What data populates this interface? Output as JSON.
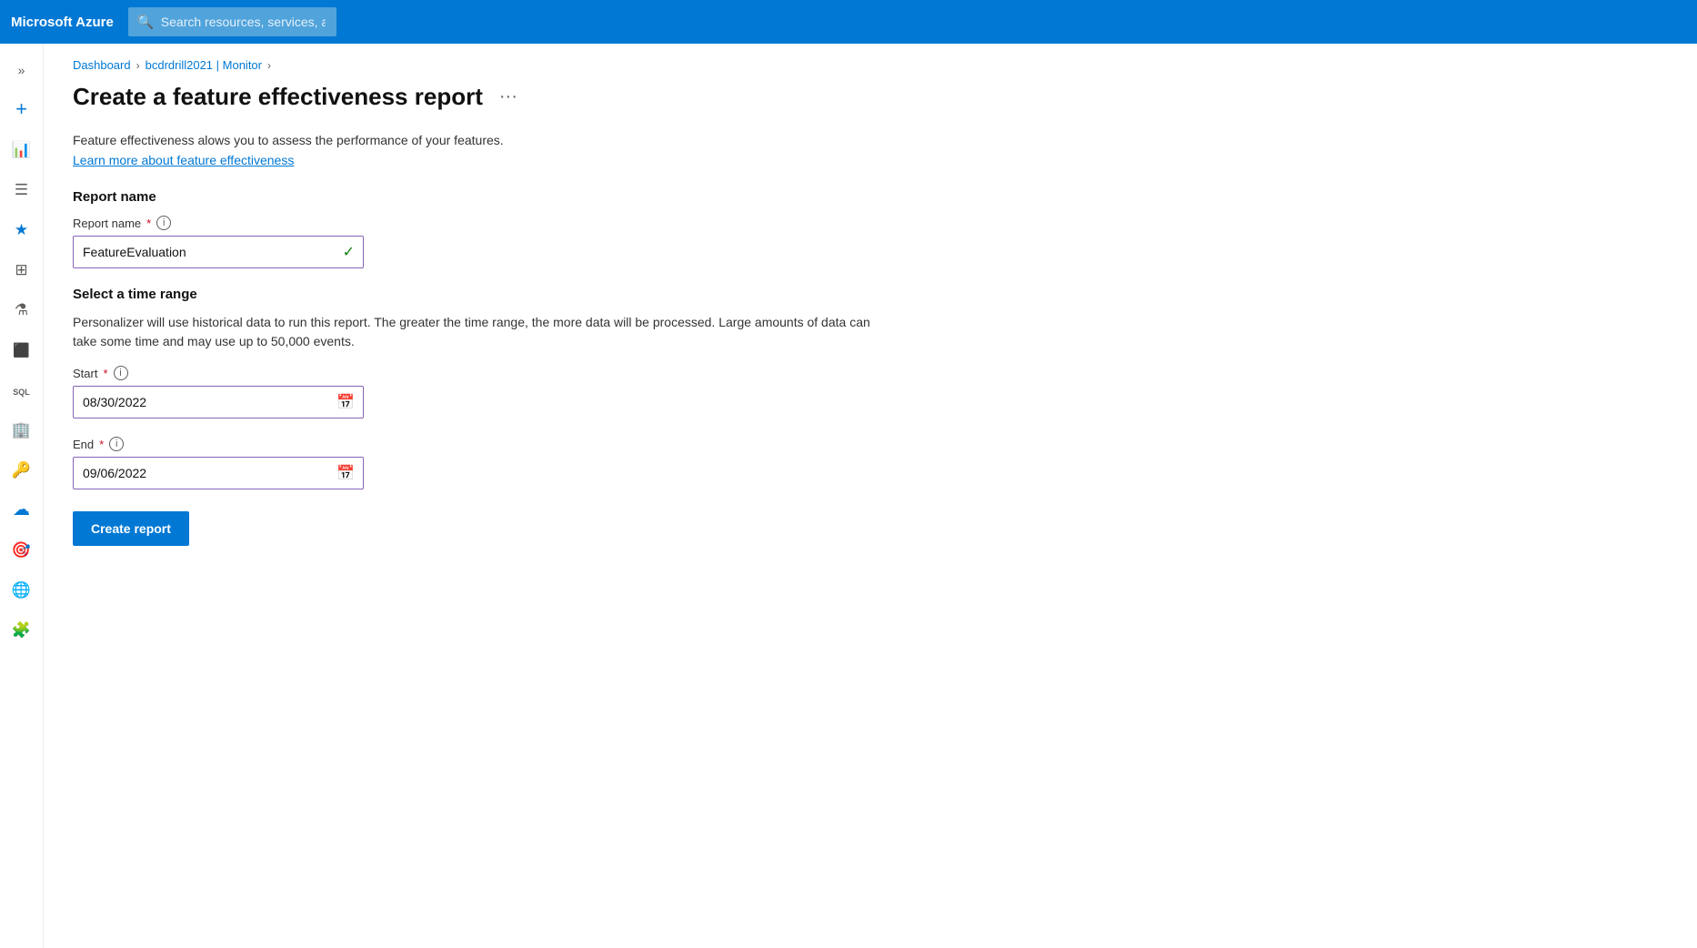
{
  "topbar": {
    "brand": "Microsoft Azure",
    "search_placeholder": "Search resources, services, and docs (G+/)"
  },
  "breadcrumb": {
    "items": [
      {
        "label": "Dashboard",
        "href": "#"
      },
      {
        "label": "bcdrdrill2021 | Monitor",
        "href": "#"
      }
    ]
  },
  "page": {
    "title": "Create a feature effectiveness report",
    "more_menu_label": "···",
    "description": "Feature effectiveness alows you to assess the performance of your features.",
    "learn_more_text": "Learn more about feature effectiveness"
  },
  "report_name_section": {
    "heading": "Report name",
    "field_label": "Report name",
    "required": "*",
    "value": "FeatureEvaluation"
  },
  "time_range_section": {
    "heading": "Select a time range",
    "description": "Personalizer will use historical data to run this report. The greater the time range, the more data will be processed. Large amounts of data can take some time and may use up to 50,000 events.",
    "start_label": "Start",
    "start_required": "*",
    "start_value": "08/30/2022",
    "end_label": "End",
    "end_required": "*",
    "end_value": "09/06/2022"
  },
  "create_button": {
    "label": "Create report"
  },
  "sidebar": {
    "items": [
      {
        "name": "chevron-toggle",
        "icon": "icon-chevron"
      },
      {
        "name": "add",
        "icon": "icon-add"
      },
      {
        "name": "bar-chart",
        "icon": "icon-bar-chart"
      },
      {
        "name": "list",
        "icon": "icon-list"
      },
      {
        "name": "star",
        "icon": "icon-star"
      },
      {
        "name": "grid",
        "icon": "icon-grid"
      },
      {
        "name": "flask",
        "icon": "icon-flask"
      },
      {
        "name": "cube",
        "icon": "icon-cube"
      },
      {
        "name": "sql",
        "icon": "icon-sql"
      },
      {
        "name": "building",
        "icon": "icon-building"
      },
      {
        "name": "key",
        "icon": "icon-key"
      },
      {
        "name": "cloud",
        "icon": "icon-cloud"
      },
      {
        "name": "radar",
        "icon": "icon-radar"
      },
      {
        "name": "globe",
        "icon": "icon-globe"
      },
      {
        "name": "puzzle",
        "icon": "icon-puzzle"
      }
    ]
  }
}
